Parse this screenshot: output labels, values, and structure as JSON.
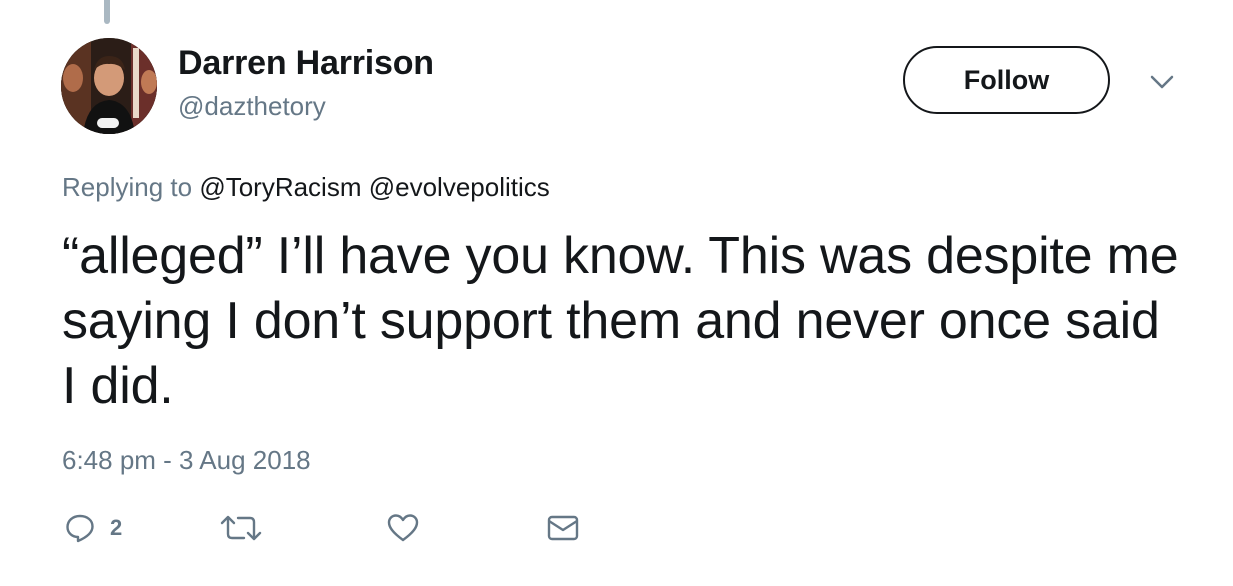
{
  "tweet": {
    "author": {
      "name": "Darren Harrison",
      "handle": "@dazthetory"
    },
    "follow_label": "Follow",
    "replying_to_prefix": "Replying to",
    "replying_to": [
      "@ToryRacism",
      "@evolvepolitics"
    ],
    "text": "“alleged” I’ll have you know. This was despite me saying I don’t support them and never once said I did.",
    "timestamp": "6:48 pm - 3 Aug 2018",
    "actions": {
      "reply_count": "2",
      "reply_icon": "reply-icon",
      "retweet_icon": "retweet-icon",
      "like_icon": "heart-icon",
      "dm_icon": "envelope-icon"
    }
  },
  "colors": {
    "text_primary": "#14171a",
    "text_secondary": "#657786",
    "thread_line": "#aab8c2"
  }
}
